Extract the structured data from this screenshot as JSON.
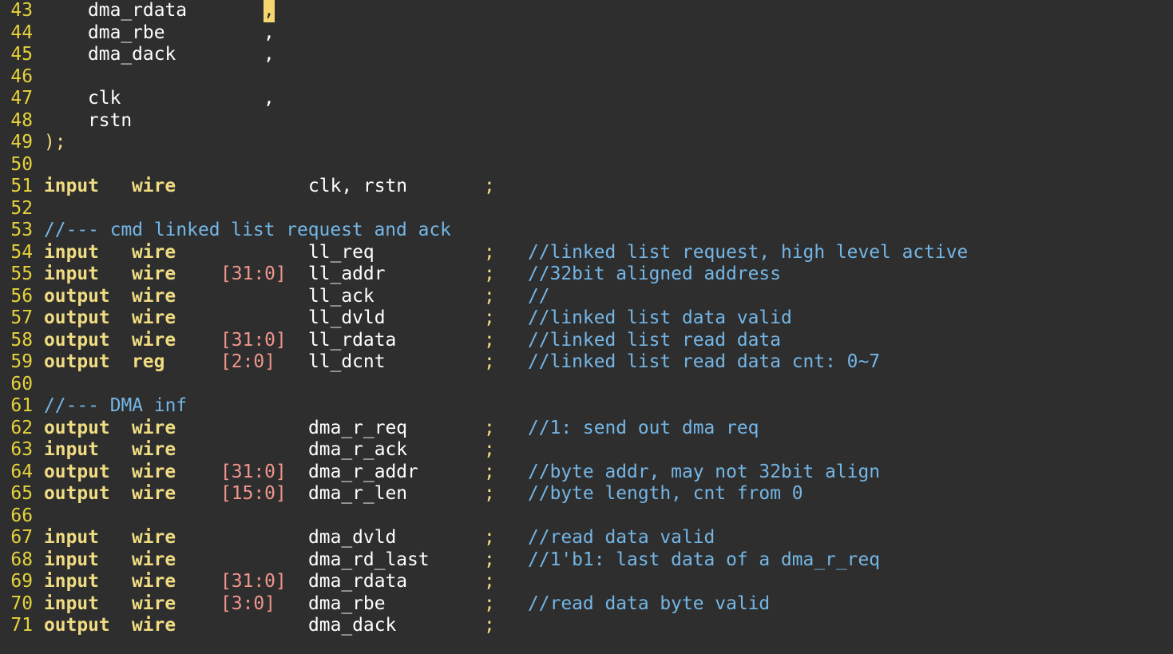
{
  "editor": {
    "lines": [
      {
        "num": "43",
        "indent_ident": "dma_rdata",
        "comma": ",",
        "cursor": true
      },
      {
        "num": "44",
        "indent_ident": "dma_rbe",
        "comma": ","
      },
      {
        "num": "45",
        "indent_ident": "dma_dack",
        "comma": ","
      },
      {
        "num": "46"
      },
      {
        "num": "47",
        "indent_ident": "clk",
        "comma": ","
      },
      {
        "num": "48",
        "indent_ident": "rstn"
      },
      {
        "num": "49",
        "text": ");"
      },
      {
        "num": "50"
      },
      {
        "num": "51",
        "dir": "input",
        "type": "wire",
        "name": "clk, rstn",
        "semi": ";"
      },
      {
        "num": "52"
      },
      {
        "num": "53",
        "comment_full": "//--- cmd linked list request and ack"
      },
      {
        "num": "54",
        "dir": "input",
        "type": "wire",
        "name": "ll_req",
        "semi": ";",
        "comment": "//linked list request, high level active"
      },
      {
        "num": "55",
        "dir": "input",
        "type": "wire",
        "range": "[31:0]",
        "name": "ll_addr",
        "semi": ";",
        "comment": "//32bit aligned address"
      },
      {
        "num": "56",
        "dir": "output",
        "type": "wire",
        "name": "ll_ack",
        "semi": ";",
        "comment": "//"
      },
      {
        "num": "57",
        "dir": "output",
        "type": "wire",
        "name": "ll_dvld",
        "semi": ";",
        "comment": "//linked list data valid"
      },
      {
        "num": "58",
        "dir": "output",
        "type": "wire",
        "range": "[31:0]",
        "name": "ll_rdata",
        "semi": ";",
        "comment": "//linked list read data"
      },
      {
        "num": "59",
        "dir": "output",
        "type": "reg",
        "range": "[2:0]",
        "name": "ll_dcnt",
        "semi": ";",
        "comment": "//linked list read data cnt: 0~7"
      },
      {
        "num": "60"
      },
      {
        "num": "61",
        "comment_full": "//--- DMA inf"
      },
      {
        "num": "62",
        "dir": "output",
        "type": "wire",
        "name": "dma_r_req",
        "semi": ";",
        "comment": "//1: send out dma req"
      },
      {
        "num": "63",
        "dir": "input",
        "type": "wire",
        "name": "dma_r_ack",
        "semi": ";"
      },
      {
        "num": "64",
        "dir": "output",
        "type": "wire",
        "range": "[31:0]",
        "name": "dma_r_addr",
        "semi": ";",
        "comment": "//byte addr, may not 32bit align"
      },
      {
        "num": "65",
        "dir": "output",
        "type": "wire",
        "range": "[15:0]",
        "name": "dma_r_len",
        "semi": ";",
        "comment": "//byte length, cnt from 0"
      },
      {
        "num": "66"
      },
      {
        "num": "67",
        "dir": "input",
        "type": "wire",
        "name": "dma_dvld",
        "semi": ";",
        "comment": "//read data valid"
      },
      {
        "num": "68",
        "dir": "input",
        "type": "wire",
        "name": "dma_rd_last",
        "semi": ";",
        "comment": "//1'b1: last data of a dma_r_req"
      },
      {
        "num": "69",
        "dir": "input",
        "type": "wire",
        "range": "[31:0]",
        "name": "dma_rdata",
        "semi": ";"
      },
      {
        "num": "70",
        "dir": "input",
        "type": "wire",
        "range": "[3:0]",
        "name": "dma_rbe",
        "semi": ";",
        "comment": "//read data byte valid"
      },
      {
        "num": "71",
        "dir": "output",
        "type": "wire",
        "name": "dma_dack",
        "semi": ";"
      }
    ]
  },
  "colors": {
    "background": "#2e2e2e",
    "line_number": "#e6d33b",
    "keyword": "#f0dc82",
    "range": "#f0968c",
    "comment": "#74b6e6",
    "identifier": "#ffffff",
    "cursor": "#f5d76e"
  }
}
